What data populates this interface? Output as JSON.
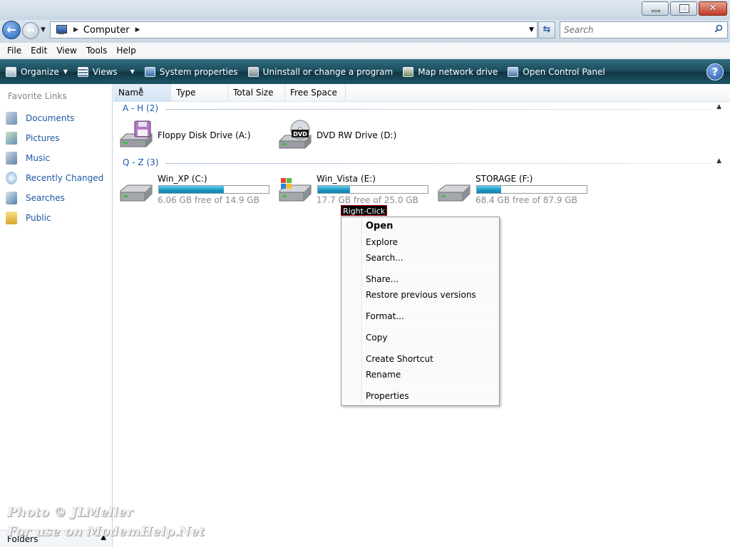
{
  "window": {
    "minimize_glyph": "",
    "maximize_glyph": "",
    "close_glyph": "✕"
  },
  "nav": {
    "back_glyph": "←",
    "forward_glyph": "→",
    "address_crumb": "Computer",
    "search_placeholder": "Search"
  },
  "menubar": {
    "items": [
      "File",
      "Edit",
      "View",
      "Tools",
      "Help"
    ]
  },
  "commandbar": {
    "organize": "Organize",
    "views": "Views",
    "system_properties": "System properties",
    "uninstall": "Uninstall or change a program",
    "map_drive": "Map network drive",
    "control_panel": "Open Control Panel",
    "help_glyph": "?"
  },
  "leftnav": {
    "title": "Favorite Links",
    "items": [
      "Documents",
      "Pictures",
      "Music",
      "Recently Changed",
      "Searches",
      "Public"
    ],
    "folders_label": "Folders"
  },
  "columns": [
    "Name",
    "Type",
    "Total Size",
    "Free Space"
  ],
  "groups": {
    "a_h": "A - H (2)",
    "q_z": "Q - Z (3)"
  },
  "drives": {
    "floppy": {
      "name": "Floppy Disk Drive (A:)"
    },
    "dvd": {
      "name": "DVD RW Drive (D:)",
      "badge": "DVD"
    },
    "c": {
      "name": "Win_XP (C:)",
      "free": "6.06 GB free of 14.9 GB",
      "used_fraction": 0.59
    },
    "e": {
      "name": "Win_Vista (E:)",
      "free": "17.7 GB free of 25.0 GB",
      "used_fraction": 0.29
    },
    "f": {
      "name": "STORAGE (F:)",
      "free": "68.4 GB free of 87.9 GB",
      "used_fraction": 0.22
    }
  },
  "annotation": "Right-Click",
  "context_menu": {
    "open": "Open",
    "explore": "Explore",
    "search": "Search...",
    "share": "Share...",
    "restore": "Restore previous versions",
    "format": "Format...",
    "copy": "Copy",
    "shortcut": "Create Shortcut",
    "rename": "Rename",
    "properties": "Properties"
  },
  "watermark": {
    "line1": "Photo © JLMeller",
    "line2": "For use on ModemHelp.Net"
  },
  "colors": {
    "link_blue": "#1d58a6",
    "cmdbar_teal": "#1b4b5b",
    "progress_blue": "#1f96c4"
  }
}
